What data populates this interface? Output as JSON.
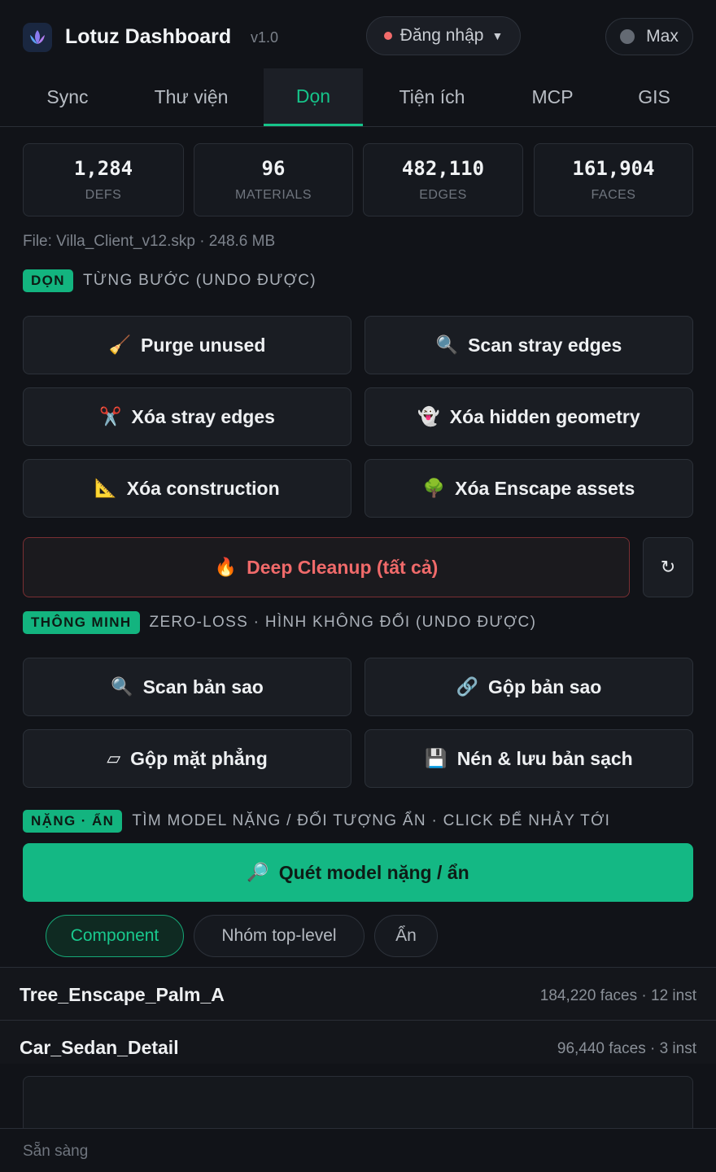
{
  "header": {
    "title": "Lotuz Dashboard",
    "version": "v1.0",
    "login_label": "Đăng nhập",
    "user_label": "Max"
  },
  "tabs": [
    {
      "label": "Sync"
    },
    {
      "label": "Thư viện"
    },
    {
      "label": "Dọn",
      "active": true
    },
    {
      "label": "Tiện ích"
    },
    {
      "label": "MCP"
    },
    {
      "label": "GIS"
    }
  ],
  "stats": [
    {
      "value": "1,284",
      "label": "DEFS"
    },
    {
      "value": "96",
      "label": "MATERIALS"
    },
    {
      "value": "482,110",
      "label": "EDGES"
    },
    {
      "value": "161,904",
      "label": "FACES"
    }
  ],
  "file_info": "File: Villa_Client_v12.skp · 248.6 MB",
  "clean_section": {
    "badge": "DỌN",
    "text": "TỪNG BƯỚC (UNDO ĐƯỢC)",
    "buttons": [
      {
        "icon": "🧹",
        "icon_name": "broom-icon",
        "label": "Purge unused"
      },
      {
        "icon": "🔍",
        "icon_name": "magnifier-icon",
        "label": "Scan stray edges"
      },
      {
        "icon": "✂️",
        "icon_name": "scissors-icon",
        "label": "Xóa stray edges"
      },
      {
        "icon": "👻",
        "icon_name": "ghost-icon",
        "label": "Xóa hidden geometry"
      },
      {
        "icon": "📐",
        "icon_name": "ruler-triangle-icon",
        "label": "Xóa construction"
      },
      {
        "icon": "🌳",
        "icon_name": "tree-icon",
        "label": "Xóa Enscape assets"
      }
    ],
    "deep_cleanup": {
      "icon": "🔥",
      "label": "Deep Cleanup (tất cả)"
    },
    "refresh_icon": "↻"
  },
  "smart_section": {
    "badge": "THÔNG MINH",
    "text": "ZERO-LOSS · HÌNH KHÔNG ĐỔI (UNDO ĐƯỢC)",
    "buttons": [
      {
        "icon": "🔍",
        "icon_name": "magnifier-icon",
        "label": "Scan bản sao"
      },
      {
        "icon": "🔗",
        "icon_name": "link-icon",
        "label": "Gộp bản sao"
      },
      {
        "icon": "▱",
        "icon_name": "parallelogram-icon",
        "label": "Gộp mặt phẳng"
      },
      {
        "icon": "💾",
        "icon_name": "floppy-disk-icon",
        "label": "Nén & lưu bản sạch"
      }
    ]
  },
  "heavy_section": {
    "badge": "NẶNG · ẨN",
    "text": "TÌM MODEL NẶNG / ĐỐI TƯỢNG ẨN · CLICK ĐỂ NHẢY TỚI",
    "scan_button": {
      "icon": "🔎",
      "label": "Quét model nặng / ẩn"
    },
    "filters": [
      {
        "label": "Component",
        "active": true
      },
      {
        "label": "Nhóm top-level"
      },
      {
        "label": "Ẩn"
      }
    ],
    "results": [
      {
        "name": "Tree_Enscape_Palm_A",
        "meta": "184,220 faces · 12 inst"
      },
      {
        "name": "Car_Sedan_Detail",
        "meta": "96,440 faces · 3 inst"
      }
    ]
  },
  "status": "Sẵn sàng",
  "colors": {
    "accent": "#16c48a",
    "danger": "#f06a6a",
    "background": "#111318"
  }
}
